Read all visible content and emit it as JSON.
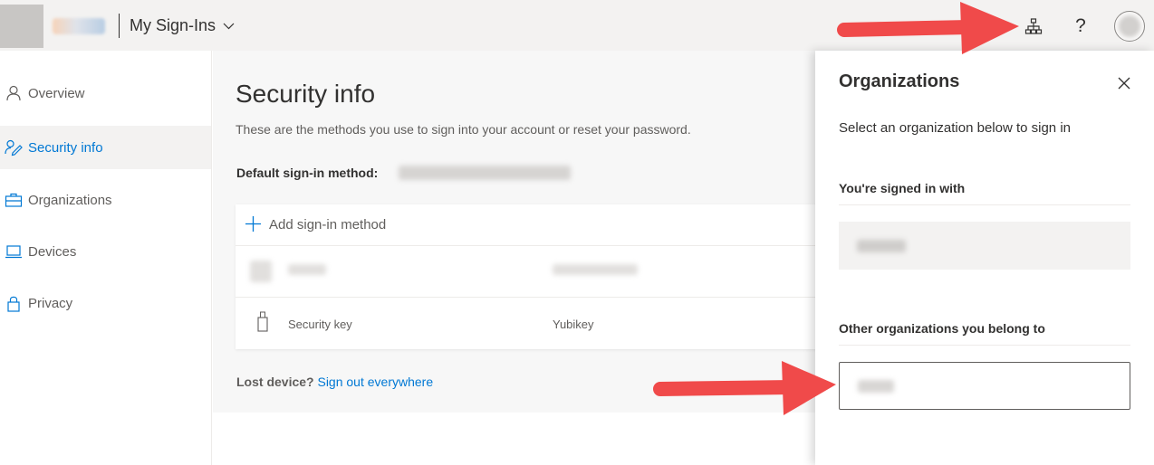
{
  "header": {
    "app_title": "My Sign-Ins",
    "icons": [
      "app-launcher-icon",
      "chevron-down-icon",
      "organization-icon",
      "help-icon",
      "avatar"
    ],
    "help_glyph": "?"
  },
  "sidebar": {
    "items": [
      {
        "label": "Overview",
        "icon": "person-icon",
        "active": false
      },
      {
        "label": "Security info",
        "icon": "security-info-icon",
        "active": true
      },
      {
        "label": "Organizations",
        "icon": "briefcase-icon",
        "active": false
      },
      {
        "label": "Devices",
        "icon": "laptop-icon",
        "active": false
      },
      {
        "label": "Privacy",
        "icon": "lock-icon",
        "active": false
      }
    ]
  },
  "main": {
    "title": "Security info",
    "subtitle": "These are the methods you use to sign into your account or reset your password.",
    "default_method_label": "Default sign-in method:",
    "add_method_label": "Add sign-in method",
    "methods": [
      {
        "type": "phone",
        "icon": "phone-icon",
        "redacted": true
      },
      {
        "type": "Security key",
        "detail": "Yubikey",
        "icon": "usb-key-icon",
        "redacted": false
      }
    ],
    "lost_device_label": "Lost device?",
    "sign_out_link": "Sign out everywhere"
  },
  "panel": {
    "title": "Organizations",
    "subtitle": "Select an organization below to sign in",
    "signed_in_heading": "You're signed in with",
    "other_orgs_heading": "Other organizations you belong to"
  },
  "colors": {
    "accent": "#0078d4",
    "header_bg": "#f3f2f1",
    "annotation_arrow": "#f04a4a"
  }
}
